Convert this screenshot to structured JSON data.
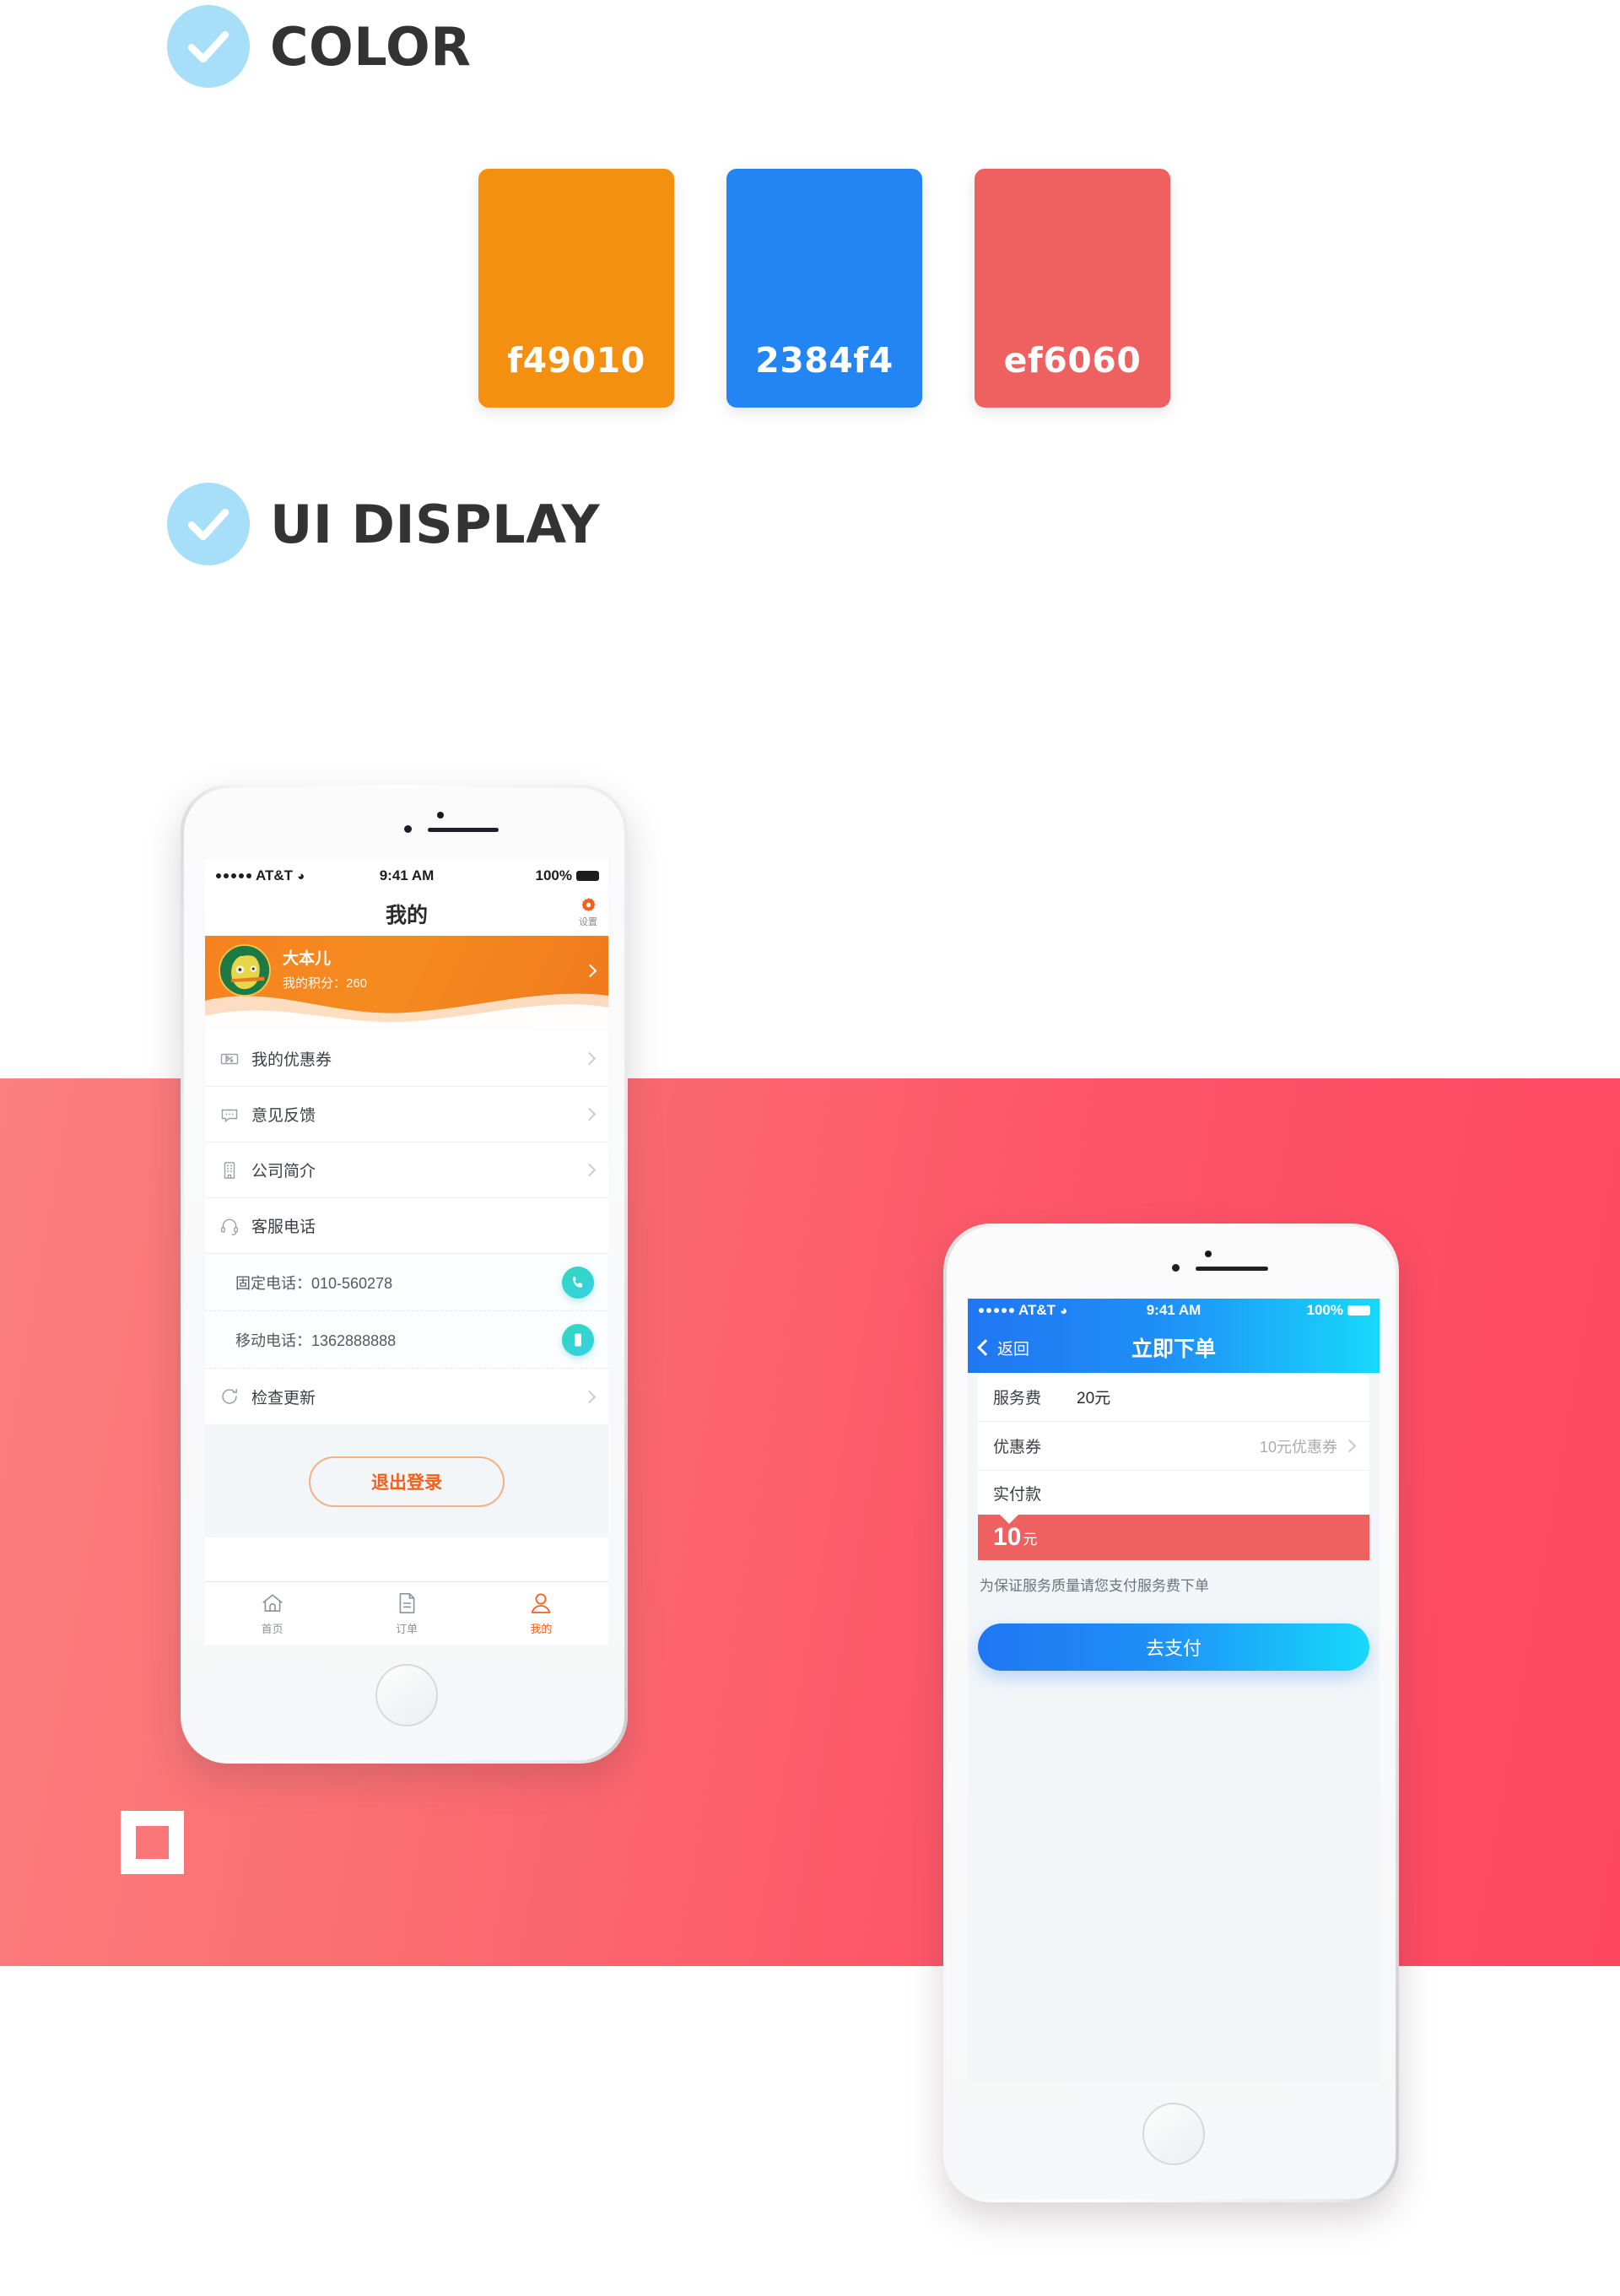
{
  "sections": [
    {
      "title": "COLOR",
      "icon": "check-circle-icon"
    },
    {
      "title": "UI DISPLAY",
      "icon": "check-circle-icon"
    }
  ],
  "palette": [
    {
      "hex": "f49010",
      "label": "f49010"
    },
    {
      "hex": "2384f4",
      "label": "2384f4"
    },
    {
      "hex": "ef6060",
      "label": "ef6060"
    }
  ],
  "brand": {
    "square_logo": "square-outline-logo",
    "band_color": "#fd5568"
  },
  "phone1": {
    "status": {
      "carrier": "AT&T",
      "wifi_icon": "wifi-icon",
      "time": "9:41 AM",
      "battery_percent": "100%",
      "battery_icon": "battery-full-icon",
      "text_color": "#1d1d1f",
      "bg_color": "#ffffff"
    },
    "nav": {
      "title": "我的",
      "settings_label": "设置",
      "settings_icon": "gear-icon"
    },
    "profile": {
      "name": "大本儿",
      "points_label": "我的积分：260",
      "avatar_icon": "duck-avatar",
      "chevron_icon": "chevron-right-icon"
    },
    "menu": [
      {
        "label": "我的优惠券",
        "icon": "coupon-icon"
      },
      {
        "label": "意见反馈",
        "icon": "chat-bubble-icon"
      },
      {
        "label": "公司简介",
        "icon": "building-icon"
      }
    ],
    "service": {
      "label": "客服电话",
      "icon": "headset-icon",
      "entries": [
        {
          "text": "固定电话：010-560278",
          "button_icon": "phone-icon"
        },
        {
          "text": "移动电话：1362888888",
          "button_icon": "mobile-icon"
        }
      ]
    },
    "update": {
      "label": "检查更新",
      "icon": "refresh-icon"
    },
    "logout_label": "退出登录",
    "tabs": [
      {
        "label": "首页",
        "icon": "home-icon",
        "active": false
      },
      {
        "label": "订单",
        "icon": "document-icon",
        "active": false
      },
      {
        "label": "我的",
        "icon": "user-icon",
        "active": true
      }
    ]
  },
  "phone2": {
    "status": {
      "carrier": "AT&T",
      "wifi_icon": "wifi-icon",
      "time": "9:41 AM",
      "battery_percent": "100%",
      "battery_icon": "battery-full-icon",
      "text_color": "#ffffff"
    },
    "nav": {
      "back_label": "返回",
      "back_icon": "chevron-left-icon",
      "title": "立即下单"
    },
    "order": {
      "fee_label": "服务费",
      "fee_value": "20元",
      "coupon_label": "优惠券",
      "coupon_value": "10元优惠券",
      "coupon_chevron": "chevron-right-icon",
      "total_label": "实付款",
      "total_amount": "10",
      "total_unit": "元",
      "note": "为保证服务质量请您支付服务费下单",
      "pay_button": "去支付"
    }
  }
}
